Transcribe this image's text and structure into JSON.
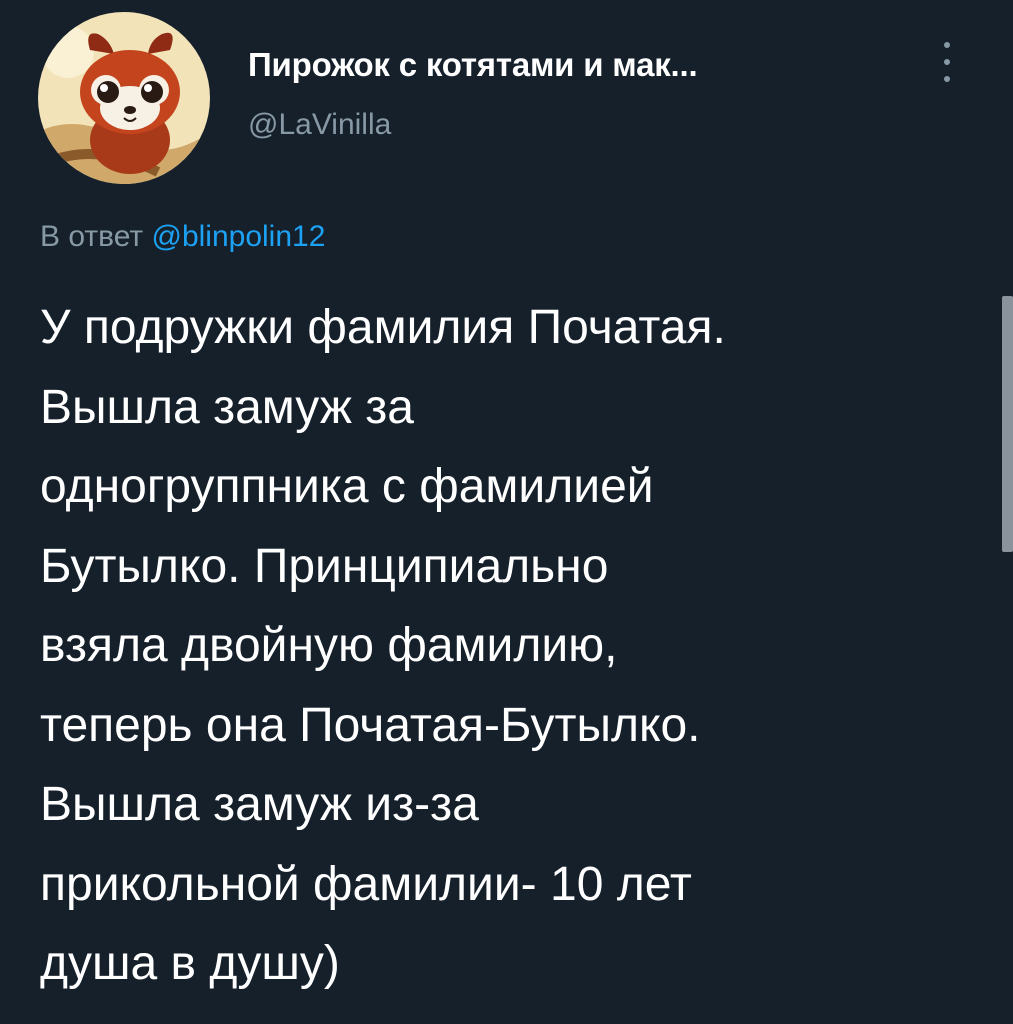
{
  "tweet": {
    "author": {
      "display_name": "Пирожок с котятами и мак...",
      "handle": "@LaVinilla",
      "avatar_icon": "red-panda-avatar-icon"
    },
    "menu_icon": "more-vertical-icon",
    "reply_to": {
      "prefix": "В ответ",
      "mention": "@blinpolin12"
    },
    "text_lines": [
      "У подружки фамилия Початая.",
      "Вышла замуж за",
      "одногруппника с фамилией",
      "Бутылко. Принципиально",
      "взяла двойную фамилию,",
      "теперь она Початая-Бутылко.",
      "Вышла замуж из-за",
      "прикольной фамилии- 10 лет",
      "душа в душу)"
    ]
  },
  "colors": {
    "background": "#15202b",
    "primary_text": "#ffffff",
    "secondary_text": "#8899a6",
    "link": "#1da1f2"
  }
}
